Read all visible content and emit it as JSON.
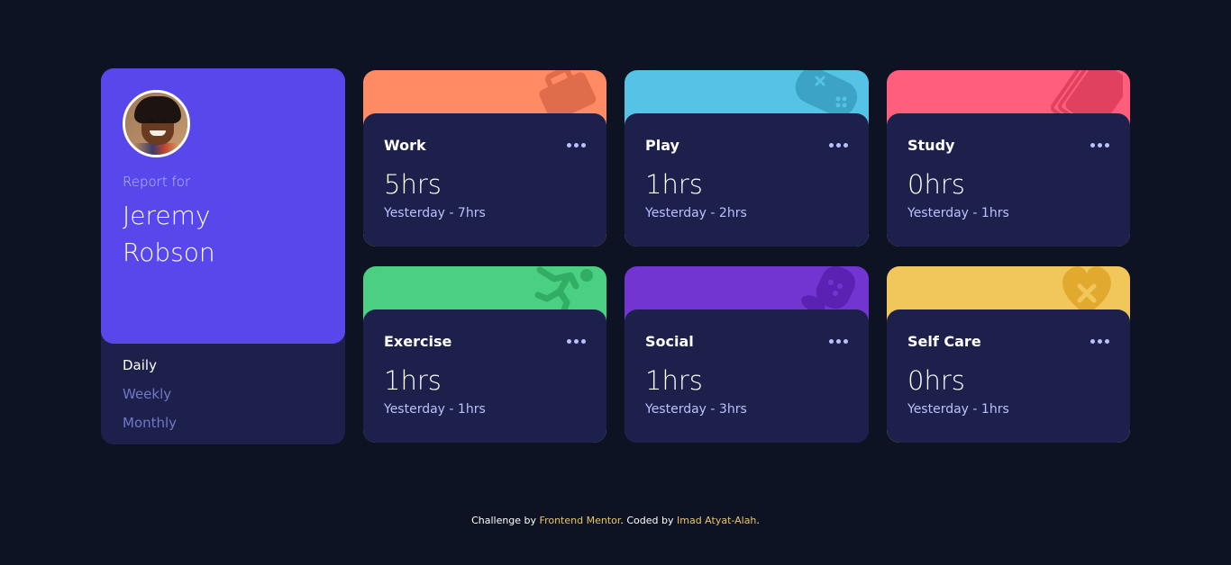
{
  "profile": {
    "report_for": "Report for",
    "name_first": "Jeremy",
    "name_last": "Robson"
  },
  "periods": [
    {
      "label": "Daily",
      "active": true
    },
    {
      "label": "Weekly",
      "active": false
    },
    {
      "label": "Monthly",
      "active": false
    }
  ],
  "cards": [
    {
      "title": "Work",
      "current": "5hrs",
      "previous": "Yesterday - 7hrs",
      "color": "#ff8b64",
      "icon": "briefcase-icon"
    },
    {
      "title": "Play",
      "current": "1hrs",
      "previous": "Yesterday - 2hrs",
      "color": "#55c2e6",
      "icon": "gamepad-icon"
    },
    {
      "title": "Study",
      "current": "0hrs",
      "previous": "Yesterday - 1hrs",
      "color": "#ff5e7d",
      "icon": "book-icon"
    },
    {
      "title": "Exercise",
      "current": "1hrs",
      "previous": "Yesterday - 1hrs",
      "color": "#4bcf82",
      "icon": "running-icon"
    },
    {
      "title": "Social",
      "current": "1hrs",
      "previous": "Yesterday - 3hrs",
      "color": "#7335d2",
      "icon": "social-icon"
    },
    {
      "title": "Self Care",
      "current": "0hrs",
      "previous": "Yesterday - 1hrs",
      "color": "#f1c75b",
      "icon": "heart-icon"
    }
  ],
  "footer": {
    "prefix": "Challenge by ",
    "challenge_link": "Frontend Mentor",
    "middle": ". Coded by ",
    "author_link": "Imad Atyat-Alah",
    "suffix": "."
  }
}
